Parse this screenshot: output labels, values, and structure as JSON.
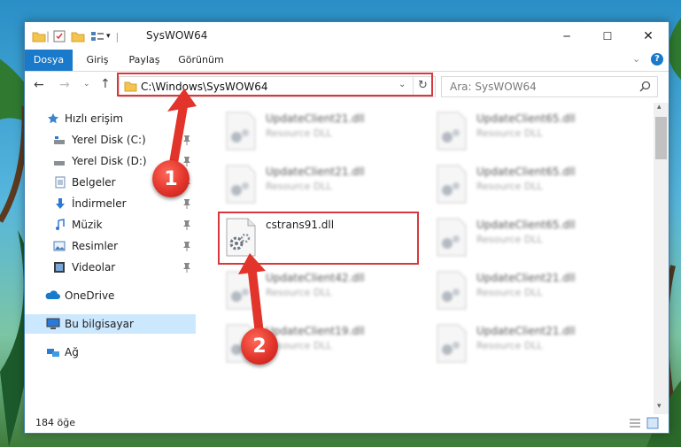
{
  "window": {
    "title": "SysWOW64",
    "controls": {
      "minimize": "─",
      "maximize": "☐",
      "close": "✕"
    }
  },
  "ribbon": {
    "tabs": [
      "Dosya",
      "Giriş",
      "Paylaş",
      "Görünüm"
    ],
    "accent": "#1979ca"
  },
  "navigation": {
    "address": "C:\\Windows\\SysWOW64",
    "search_placeholder": "Ara: SysWOW64"
  },
  "sidebar": {
    "quick_access": "Hızlı erişim",
    "items": [
      {
        "label": "Yerel Disk (C:)",
        "icon": "drive-icon",
        "pinned": true
      },
      {
        "label": "Yerel Disk (D:)",
        "icon": "drive-icon",
        "pinned": true
      },
      {
        "label": "Belgeler",
        "icon": "documents-icon",
        "pinned": true
      },
      {
        "label": "İndirmeler",
        "icon": "downloads-icon",
        "pinned": true
      },
      {
        "label": "Müzik",
        "icon": "music-icon",
        "pinned": true
      },
      {
        "label": "Resimler",
        "icon": "pictures-icon",
        "pinned": true
      },
      {
        "label": "Videolar",
        "icon": "videos-icon",
        "pinned": true
      }
    ],
    "onedrive": "OneDrive",
    "this_pc": "Bu bilgisayar",
    "network": "Ağ"
  },
  "files": {
    "left": [
      {
        "name": "UpdateClient21.dll",
        "desc": "Resource DLL"
      },
      {
        "name": "UpdateClient21.dll",
        "desc": "Resource DLL"
      },
      {
        "name": "cstrans91.dll",
        "desc": ""
      },
      {
        "name": "UpdateClient42.dll",
        "desc": "Resource DLL"
      },
      {
        "name": "UpdateClient19.dll",
        "desc": "Resource DLL"
      }
    ],
    "right": [
      {
        "name": "UpdateClient65.dll",
        "desc": "Resource DLL"
      },
      {
        "name": "UpdateClient65.dll",
        "desc": "Resource DLL"
      },
      {
        "name": "UpdateClient65.dll",
        "desc": "Resource DLL"
      },
      {
        "name": "UpdateClient21.dll",
        "desc": "Resource DLL"
      },
      {
        "name": "UpdateClient21.dll",
        "desc": "Resource DLL"
      }
    ]
  },
  "status": {
    "item_count": "184 öğe"
  },
  "annotations": {
    "marker1": "1",
    "marker2": "2",
    "color": "#d9373d"
  }
}
